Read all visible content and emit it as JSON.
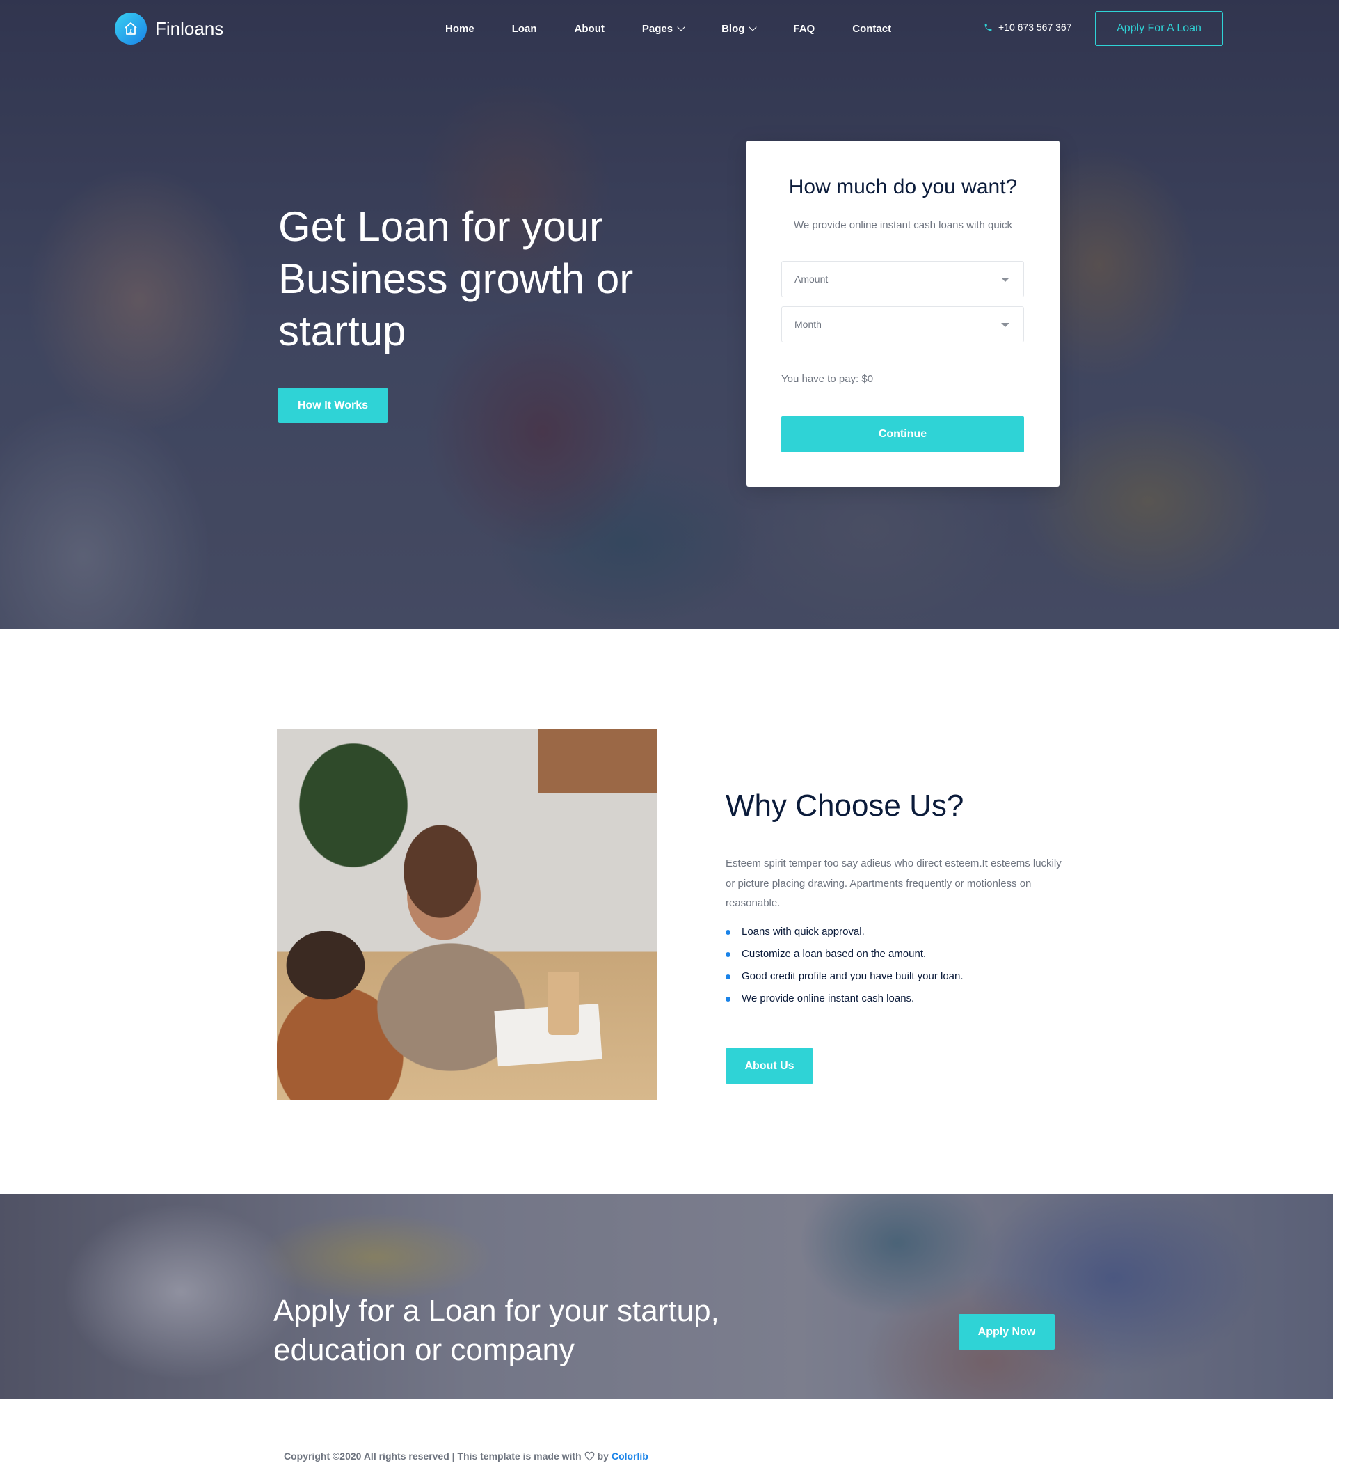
{
  "brand": {
    "name": "Finloans",
    "logo_icon": "house-icon",
    "accent": "#2fd3d6",
    "brand_blue": "#1a83e8"
  },
  "nav": {
    "items": [
      {
        "label": "Home",
        "has_dropdown": false
      },
      {
        "label": "Loan",
        "has_dropdown": false
      },
      {
        "label": "About",
        "has_dropdown": false
      },
      {
        "label": "Pages",
        "has_dropdown": true
      },
      {
        "label": "Blog",
        "has_dropdown": true
      },
      {
        "label": "FAQ",
        "has_dropdown": false
      },
      {
        "label": "Contact",
        "has_dropdown": false
      }
    ],
    "phone": "+10 673 567 367",
    "apply_button": "Apply For A Loan"
  },
  "hero": {
    "title": "Get Loan for your Business growth or startup",
    "button": "How It Works"
  },
  "loan_form": {
    "title": "How much do you want?",
    "subtitle": "We provide online instant cash loans with quick",
    "amount_select": "Amount",
    "month_select": "Month",
    "pay_text": "You have to pay: $0",
    "continue_button": "Continue"
  },
  "why": {
    "title": "Why Choose Us?",
    "text": "Esteem spirit temper too say adieus who direct esteem.It esteems luckily or picture placing drawing. Apartments frequently or motionless on reasonable.",
    "list": [
      "Loans with quick approval.",
      "Customize a loan based on the amount.",
      "Good credit profile and you have built your loan.",
      "We provide online instant cash loans."
    ],
    "button": "About Us"
  },
  "cta": {
    "title": "Apply for a Loan for your startup, education or company",
    "button": "Apply Now"
  },
  "footer": {
    "prefix": "Copyright ©2020 All rights reserved | This template is made with",
    "by": "by",
    "link": "Colorlib"
  }
}
